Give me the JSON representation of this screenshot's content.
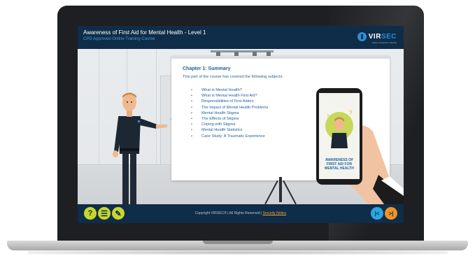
{
  "header": {
    "title": "Awareness of First Aid for Mental Health - Level 1",
    "subtitle": "CPD Approved Online Training Course",
    "logo_text_main": "VIR",
    "logo_text_accent": "SEC",
    "logo_tagline": "Online Interactive Training"
  },
  "slide": {
    "heading": "Chapter 1: Summary",
    "intro": "This part of the course has covered the following subjects:",
    "topics": [
      "What is Mental Health?",
      "What is Mental Health First Aid?",
      "Responsibilities of First Aiders",
      "The Impact of Mental Health Problems",
      "Mental Health Stigma",
      "The Effects of Stigma",
      "Coping with Stigma",
      "Mental Health Statistics",
      "Case Study: A Traumatic Experience"
    ]
  },
  "phone": {
    "line1": "AWARENESS OF",
    "line2": "FIRST AID FOR",
    "line3": "MENTAL HEALTH"
  },
  "footer": {
    "copyright": "Copyright VIRSEC® | All Rights Reserved |",
    "link": "Security Notice"
  },
  "controls": {
    "help_label": "?",
    "menu_label": "☰",
    "notes_label": "✎",
    "prev_label": "|<",
    "next_label": ">|"
  },
  "icons": {
    "help": "help-icon",
    "menu": "menu-list-icon",
    "notes": "pencil-icon",
    "prev": "previous-icon",
    "next": "next-icon"
  },
  "colors": {
    "bar": "#0f2c48",
    "accent_blue": "#2aa7e3",
    "accent_lime": "#c8d62c",
    "accent_orange": "#f39225",
    "text_blue": "#1f5f9b"
  }
}
